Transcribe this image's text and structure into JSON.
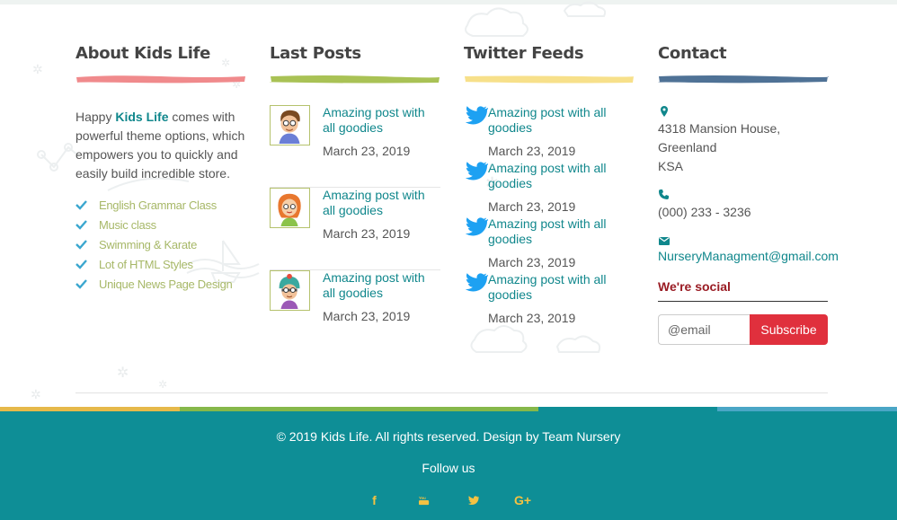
{
  "about": {
    "title": "About Kids Life",
    "text_prefix": "Happy ",
    "brand": "Kids Life",
    "text_suffix": " comes with powerful theme options, which empowers you to quickly and easily build incredible store.",
    "list": [
      "English Grammar Class",
      "Music class",
      "Swimming & Karate",
      "Lot of HTML Styles",
      "Unique News Page Design"
    ]
  },
  "posts": {
    "title": "Last Posts",
    "items": [
      {
        "title": "Amazing post with all goodies",
        "date": "March 23, 2019",
        "thumb_icon": "boy-avatar-icon"
      },
      {
        "title": "Amazing post with all goodies",
        "date": "March 23, 2019",
        "thumb_icon": "girl-avatar-icon"
      },
      {
        "title": "Amazing post with all goodies",
        "date": "March 23, 2019",
        "thumb_icon": "kid-hat-avatar-icon"
      }
    ]
  },
  "twitter": {
    "title": "Twitter Feeds",
    "items": [
      {
        "text": "Amazing post with all goodies",
        "date": "March 23, 2019"
      },
      {
        "text": "Amazing post with all goodies",
        "date": "March 23, 2019"
      },
      {
        "text": "Amazing post with all goodies",
        "date": "March 23, 2019"
      },
      {
        "text": "Amazing post with all goodies",
        "date": "March 23, 2019"
      }
    ]
  },
  "contact": {
    "title": "Contact",
    "address_lines": [
      "4318 Mansion House,",
      "Greenland",
      "KSA"
    ],
    "phone": "(000) 233 - 3236",
    "email": "NurseryManagment@gmail.com",
    "social_title": "We're social",
    "email_placeholder": "@email",
    "subscribe_label": "Subscribe"
  },
  "footer": {
    "copyright": "© 2019 Kids Life. All rights reserved. Design by Team Nursery",
    "follow": "Follow us",
    "social": [
      {
        "icon": "facebook-icon",
        "glyph": "f"
      },
      {
        "icon": "youtube-icon",
        "glyph": "▶"
      },
      {
        "icon": "twitter-icon",
        "glyph": "t"
      },
      {
        "icon": "google-plus-icon",
        "glyph": "G+"
      }
    ]
  },
  "colors": {
    "teal": "#0e8e96",
    "link": "#10878c",
    "brush_about": "#f08a8c",
    "brush_posts": "#a9c255",
    "brush_twitter": "#f7e08a",
    "brush_contact": "#4f7296",
    "subscribe": "#e0303d",
    "stripe_colors": [
      "#e6b94a",
      "#86b84a",
      "#86b84a",
      "#0e8e96",
      "#4aa6c6"
    ]
  }
}
